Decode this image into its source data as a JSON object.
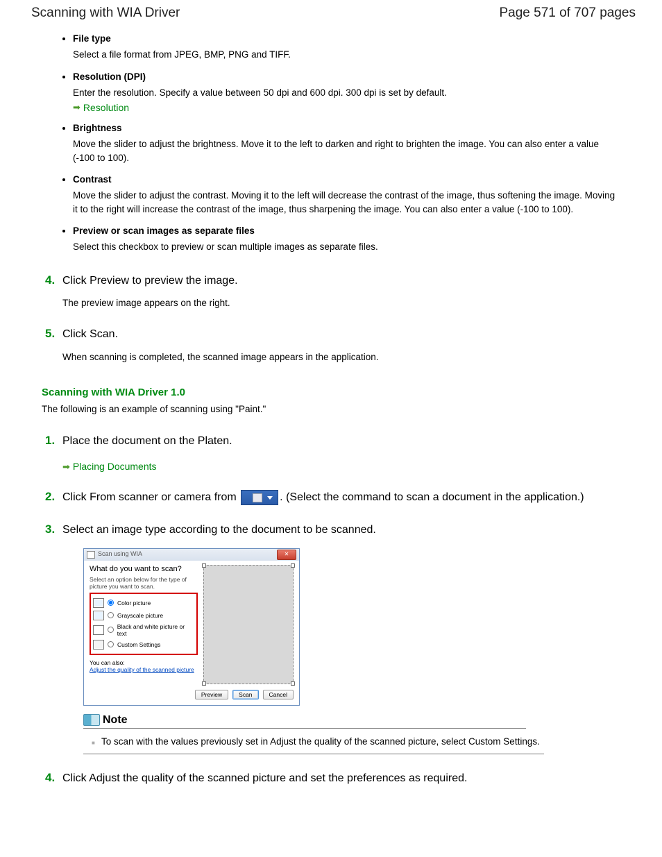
{
  "header": {
    "title": "Scanning with WIA Driver",
    "page_info": "Page 571 of 707 pages"
  },
  "bullets": [
    {
      "title": "File type",
      "desc": "Select a file format from JPEG, BMP, PNG and TIFF."
    },
    {
      "title": "Resolution (DPI)",
      "desc": "Enter the resolution. Specify a value between 50 dpi and 600 dpi. 300 dpi is set by default.",
      "link": "Resolution"
    },
    {
      "title": "Brightness",
      "desc": "Move the slider to adjust the brightness. Move it to the left to darken and right to brighten the image. You can also enter a value (-100 to 100)."
    },
    {
      "title": "Contrast",
      "desc": "Move the slider to adjust the contrast. Moving it to the left will decrease the contrast of the image, thus softening the image. Moving it to the right will increase the contrast of the image, thus sharpening the image. You can also enter a value (-100 to 100)."
    },
    {
      "title": "Preview or scan images as separate files",
      "desc": "Select this checkbox to preview or scan multiple images as separate files."
    }
  ],
  "steps_a": [
    {
      "num": "4.",
      "title": "Click Preview to preview the image.",
      "desc": "The preview image appears on the right."
    },
    {
      "num": "5.",
      "title": "Click Scan.",
      "desc": "When scanning is completed, the scanned image appears in the application."
    }
  ],
  "section": {
    "heading": "Scanning with WIA Driver 1.0",
    "desc": "The following is an example of scanning using \"Paint.\""
  },
  "steps_b": {
    "s1": {
      "num": "1.",
      "title": "Place the document on the Platen.",
      "link": "Placing Documents"
    },
    "s2": {
      "num": "2.",
      "pre": "Click From scanner or camera from ",
      "post": ". (Select the command to scan a document in the application.)"
    },
    "s3": {
      "num": "3.",
      "title": "Select an image type according to the document to be scanned."
    },
    "s4": {
      "num": "4.",
      "title": "Click Adjust the quality of the scanned picture and set the preferences as required."
    }
  },
  "dialog": {
    "title": "Scan using WIA",
    "question": "What do you want to scan?",
    "sub": "Select an option below for the type of picture you want to scan.",
    "opts": [
      "Color picture",
      "Grayscale picture",
      "Black and white picture or text",
      "Custom Settings"
    ],
    "also_label": "You can also:",
    "also_link": "Adjust the quality of the scanned picture",
    "btn_preview": "Preview",
    "btn_scan": "Scan",
    "btn_cancel": "Cancel"
  },
  "note": {
    "label": "Note",
    "text": "To scan with the values previously set in Adjust the quality of the scanned picture, select Custom Settings."
  }
}
